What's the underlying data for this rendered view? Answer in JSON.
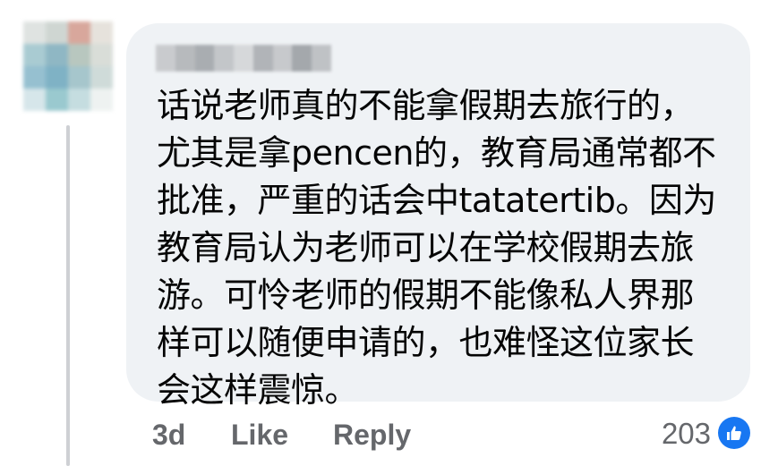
{
  "comment": {
    "text": "话说老师真的不能拿假期去旅行的，\n尤其是拿pencen的，教育局通常都不\n批准，严重的话会中tatatertib。因为\n教育局认为老师可以在学校假期去旅\n游。可怜老师的假期不能像私人界那\n样可以随便申请的，也难怪这位家长\n会这样震惊。"
  },
  "footer": {
    "time": "3d",
    "like_label": "Like",
    "reply_label": "Reply",
    "reaction_count": "203"
  },
  "icons": {
    "reaction": "thumbs-up-icon"
  },
  "colors": {
    "bubble_bg": "#eff2f5",
    "secondary_text": "#65676b",
    "like_blue": "#1877f2"
  }
}
